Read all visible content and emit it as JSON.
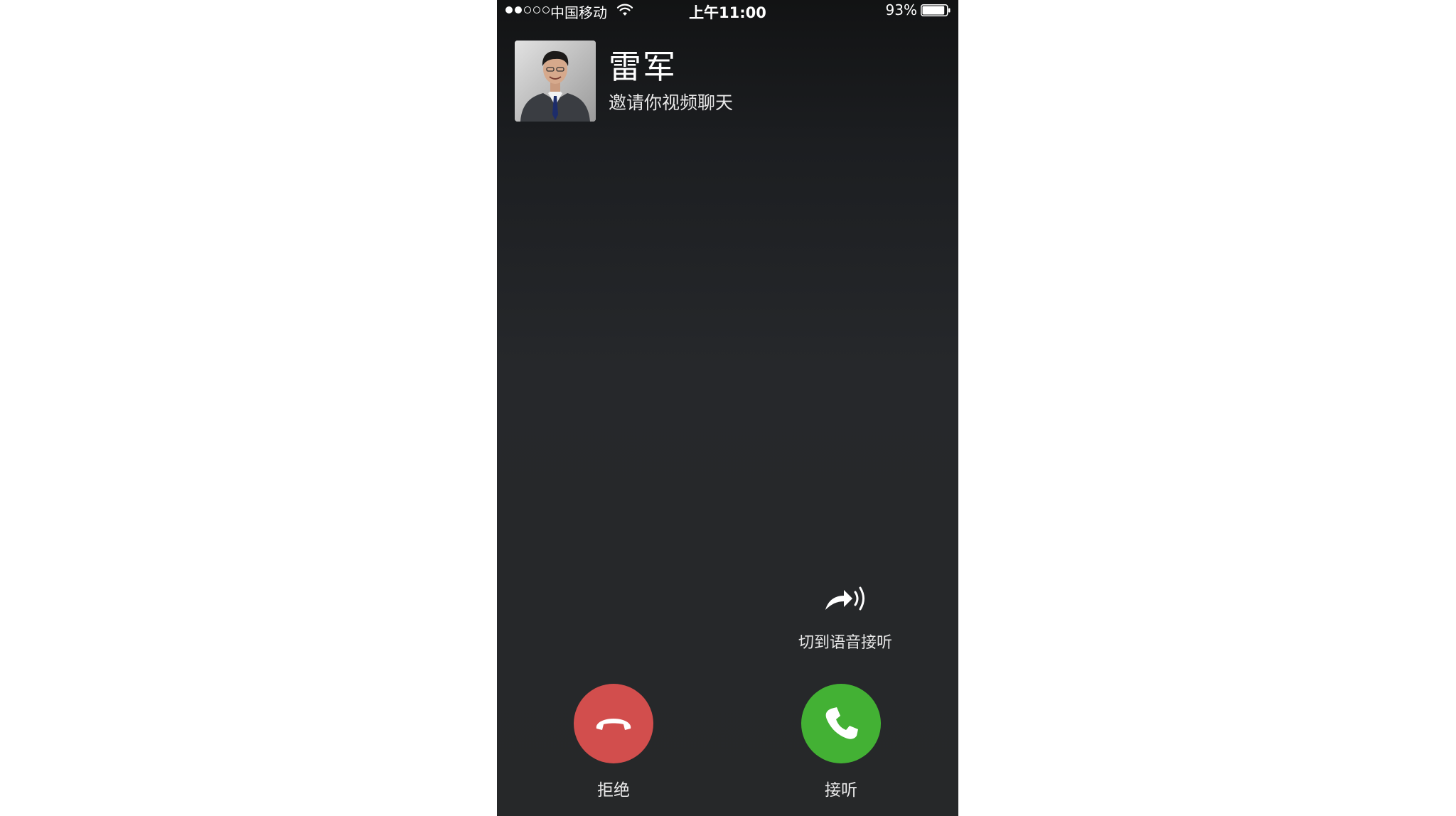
{
  "status_bar": {
    "signal_bars_filled": 2,
    "signal_bars_total": 5,
    "carrier": "中国移动",
    "time": "上午11:00",
    "battery_percent_text": "93%",
    "battery_level": 0.93,
    "icons": [
      "signal-dots",
      "wifi-icon",
      "battery-icon"
    ]
  },
  "caller": {
    "name": "雷军",
    "subtitle": "邀请你视频聊天",
    "avatar": "caller-avatar-photo"
  },
  "switch_voice": {
    "label": "切到语音接听",
    "icon": "switch-to-voice-icon"
  },
  "actions": {
    "decline": {
      "label": "拒绝",
      "icon": "hang-up-icon",
      "color": "#d24e4d"
    },
    "accept": {
      "label": "接听",
      "icon": "phone-icon",
      "color": "#43b134"
    }
  },
  "colors": {
    "background_top": "#121314",
    "background_bottom": "#262829",
    "text": "#ffffff"
  }
}
